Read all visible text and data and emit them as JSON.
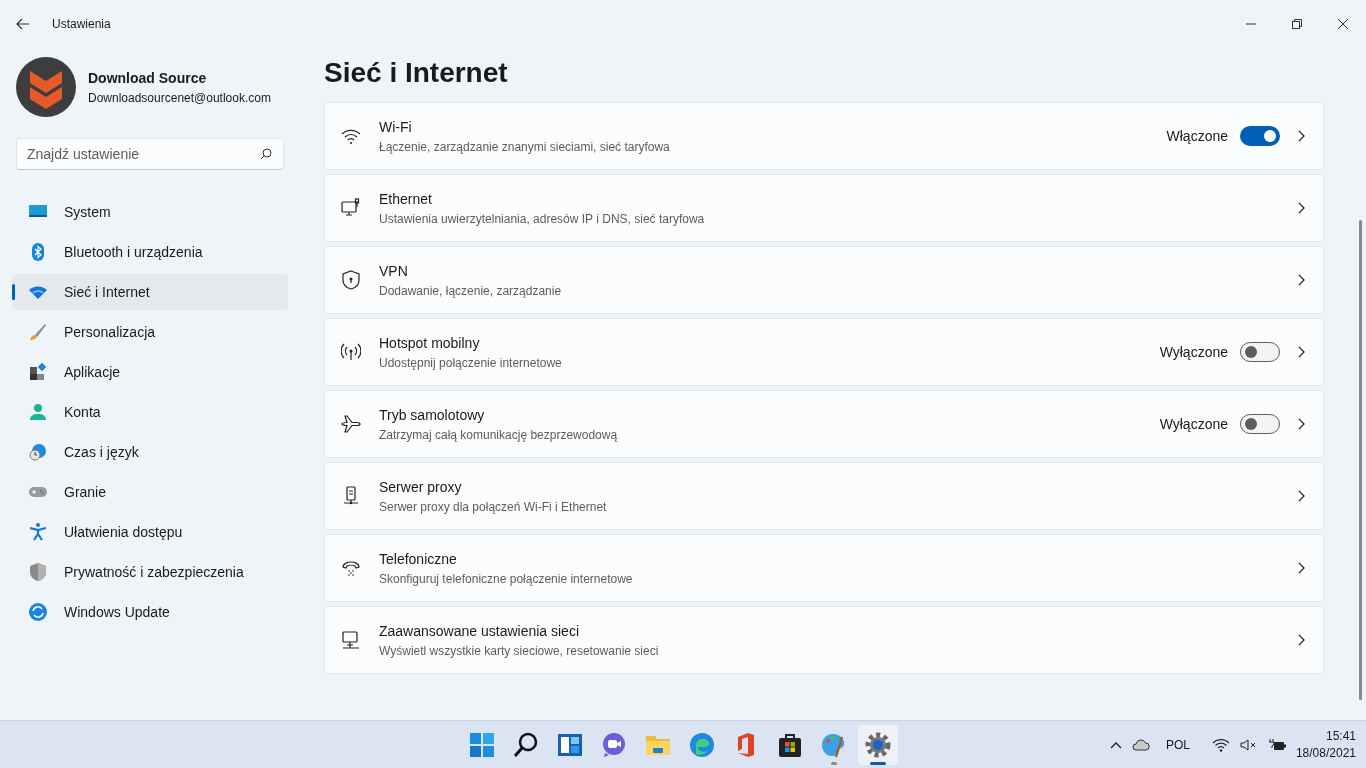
{
  "window": {
    "title": "Ustawienia"
  },
  "profile": {
    "name": "Download Source",
    "email": "Downloadsourcenet@outlook.com"
  },
  "search": {
    "placeholder": "Znajdź ustawienie"
  },
  "sidebar": {
    "items": [
      {
        "label": "System",
        "selected": false
      },
      {
        "label": "Bluetooth i urządzenia",
        "selected": false
      },
      {
        "label": "Sieć i Internet",
        "selected": true
      },
      {
        "label": "Personalizacja",
        "selected": false
      },
      {
        "label": "Aplikacje",
        "selected": false
      },
      {
        "label": "Konta",
        "selected": false
      },
      {
        "label": "Czas i język",
        "selected": false
      },
      {
        "label": "Granie",
        "selected": false
      },
      {
        "label": "Ułatwienia dostępu",
        "selected": false
      },
      {
        "label": "Prywatność i zabezpieczenia",
        "selected": false
      },
      {
        "label": "Windows Update",
        "selected": false
      }
    ]
  },
  "page_title": "Sieć i Internet",
  "settings": [
    {
      "kind": "toggle",
      "title": "Wi-Fi",
      "subtitle": "Łączenie, zarządzanie znanymi sieciami, sieć taryfowa",
      "status": "Włączone",
      "on": true
    },
    {
      "kind": "link",
      "title": "Ethernet",
      "subtitle": "Ustawienia uwierzytelniania, adresów IP i DNS, sieć taryfowa"
    },
    {
      "kind": "link",
      "title": "VPN",
      "subtitle": "Dodawanie, łączenie, zarządzanie"
    },
    {
      "kind": "toggle",
      "title": "Hotspot mobilny",
      "subtitle": "Udostępnij połączenie internetowe",
      "status": "Wyłączone",
      "on": false
    },
    {
      "kind": "toggle",
      "title": "Tryb samolotowy",
      "subtitle": "Zatrzymaj całą komunikację bezprzewodową",
      "status": "Wyłączone",
      "on": false
    },
    {
      "kind": "link",
      "title": "Serwer proxy",
      "subtitle": "Serwer proxy dla połączeń Wi-Fi i Ethernet"
    },
    {
      "kind": "link",
      "title": "Telefoniczne",
      "subtitle": "Skonfiguruj telefoniczne połączenie internetowe"
    },
    {
      "kind": "link",
      "title": "Zaawansowane ustawienia sieci",
      "subtitle": "Wyświetl wszystkie karty sieciowe, resetowanie sieci"
    }
  ],
  "taskbar": {
    "apps": [
      {
        "selected": false,
        "running": false
      },
      {
        "selected": false,
        "running": false
      },
      {
        "selected": false,
        "running": false
      },
      {
        "selected": false,
        "running": false
      },
      {
        "selected": false,
        "running": false
      },
      {
        "selected": false,
        "running": false
      },
      {
        "selected": false,
        "running": false
      },
      {
        "selected": false,
        "running": false
      },
      {
        "selected": false,
        "running": true
      },
      {
        "selected": true,
        "running": true
      }
    ],
    "language": "POL",
    "time": "15:41",
    "date": "18/08/2021"
  }
}
